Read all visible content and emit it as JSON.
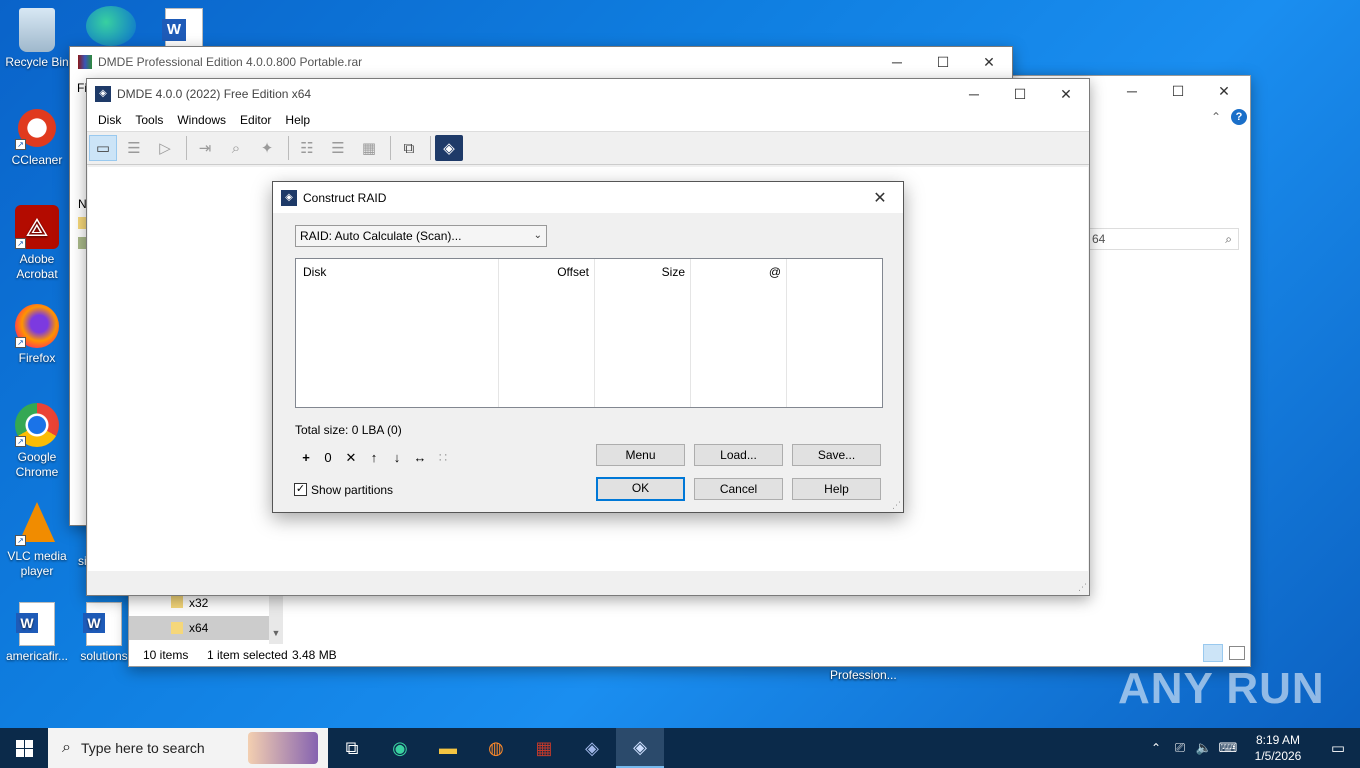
{
  "desktop": {
    "icons": [
      {
        "label": "Recycle Bin"
      },
      {
        "label": "CCleaner"
      },
      {
        "label": "Adobe Acrobat"
      },
      {
        "label": "Firefox"
      },
      {
        "label": "Google Chrome"
      },
      {
        "label": "VLC media player"
      },
      {
        "label": "americafir..."
      },
      {
        "label": "solutions"
      }
    ],
    "truncated_label_si": "si",
    "watermark": "ANY RUN"
  },
  "winrar": {
    "title": "DMDE Professional Edition 4.0.0.800 Portable.rar",
    "menu_first": "Fi"
  },
  "explorer": {
    "search_value": "64",
    "folders": [
      "x32",
      "x64"
    ],
    "status_items": "10 items",
    "status_selected": "1 item selected",
    "status_size": "3.48 MB",
    "bottom_label": "Profession...",
    "left_letter": "N"
  },
  "dmde": {
    "title": "DMDE 4.0.0 (2022) Free Edition x64",
    "menu": [
      "Disk",
      "Tools",
      "Windows",
      "Editor",
      "Help"
    ]
  },
  "dialog": {
    "title": "Construct RAID",
    "raid_select": "RAID: Auto Calculate (Scan)...",
    "columns": [
      "Disk",
      "Offset",
      "Size",
      "@"
    ],
    "total_size": "Total size: 0 LBA (0)",
    "show_partitions": "Show partitions",
    "buttons": {
      "menu": "Menu",
      "load": "Load...",
      "save": "Save...",
      "ok": "OK",
      "cancel": "Cancel",
      "help": "Help"
    },
    "mini_tools": [
      "+",
      "0",
      "✕",
      "↑",
      "↓",
      "↔",
      "∷"
    ]
  },
  "taskbar": {
    "search_placeholder": "Type here to search",
    "time": "8:19 AM",
    "date": "1/5/2026"
  }
}
